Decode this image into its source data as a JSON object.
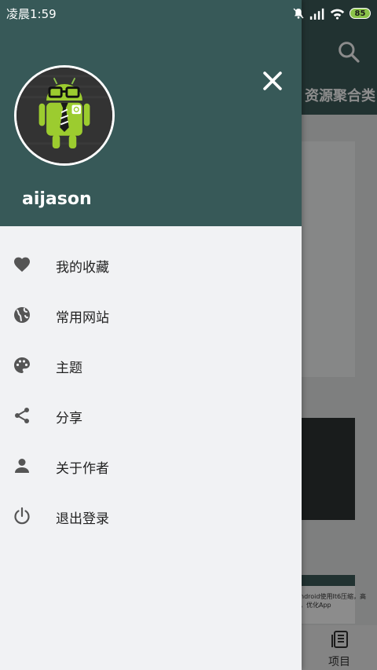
{
  "status_bar": {
    "time": "凌晨1:59",
    "battery": "85"
  },
  "background": {
    "tab_title": "资源聚合类",
    "card_snippet": "ndroid使用It6压缩，高\n，优化App",
    "bottom_nav_label": "项目"
  },
  "drawer": {
    "username": "aijason",
    "menu": [
      {
        "label": "我的收藏",
        "icon": "heart-icon"
      },
      {
        "label": "常用网站",
        "icon": "globe-icon"
      },
      {
        "label": "主题",
        "icon": "palette-icon"
      },
      {
        "label": "分享",
        "icon": "share-icon"
      },
      {
        "label": "关于作者",
        "icon": "person-icon"
      },
      {
        "label": "退出登录",
        "icon": "power-icon"
      }
    ]
  },
  "colors": {
    "header": "#375958",
    "toolbar": "#3d5b5a",
    "drawer_bg": "#f1f2f4",
    "icon": "#555555"
  }
}
